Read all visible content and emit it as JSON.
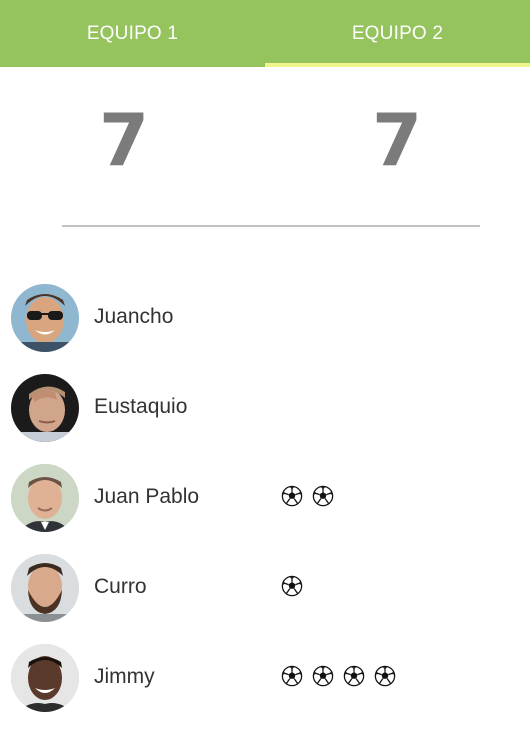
{
  "tabs": [
    {
      "label": "EQUIPO 1",
      "active": false
    },
    {
      "label": "EQUIPO 2",
      "active": true
    }
  ],
  "scores": {
    "team1": "7",
    "team2": "7"
  },
  "players": [
    {
      "name": "Juancho",
      "goals": 0,
      "avatar": "avatar-sunglasses"
    },
    {
      "name": "Eustaquio",
      "goals": 0,
      "avatar": "avatar-hand-on-head"
    },
    {
      "name": "Juan Pablo",
      "goals": 2,
      "avatar": "avatar-suit"
    },
    {
      "name": "Curro",
      "goals": 1,
      "avatar": "avatar-beard"
    },
    {
      "name": "Jimmy",
      "goals": 4,
      "avatar": "avatar-smile"
    }
  ],
  "colors": {
    "tabbar": "#95c35e",
    "active_indicator": "#eef58a",
    "score": "#7b7b7b",
    "divider": "#c2c2c2",
    "player_name": "#333333"
  },
  "icons": {
    "goal": "soccer-ball-icon"
  }
}
